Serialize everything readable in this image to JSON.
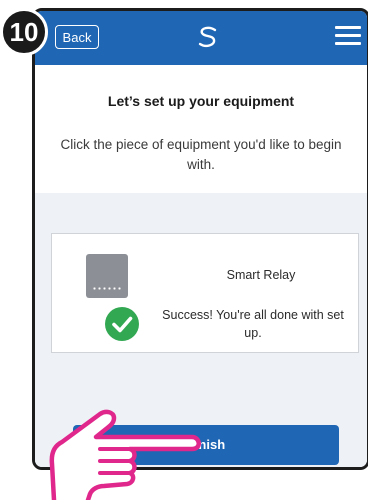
{
  "step": {
    "number": "10"
  },
  "header": {
    "back_label": "Back",
    "logo_icon": "brand-swirl-icon",
    "menu_icon": "hamburger-menu-icon"
  },
  "setup": {
    "title": "Let’s set up your equipment",
    "subtitle": "Click the piece of equipment you'd like to begin with."
  },
  "equipment": {
    "name": "Smart Relay",
    "device_icon": "smart-relay-device-icon",
    "status_icon": "success-check-icon",
    "status": "Success! You're all done with set up."
  },
  "actions": {
    "finish_label": "Finish"
  },
  "overlay": {
    "hand_icon": "pointing-hand-icon"
  },
  "colors": {
    "brand_blue": "#1f66b4",
    "success_green": "#33a853",
    "panel_bg": "#eef2f7",
    "hand_outline": "#e0288c"
  }
}
